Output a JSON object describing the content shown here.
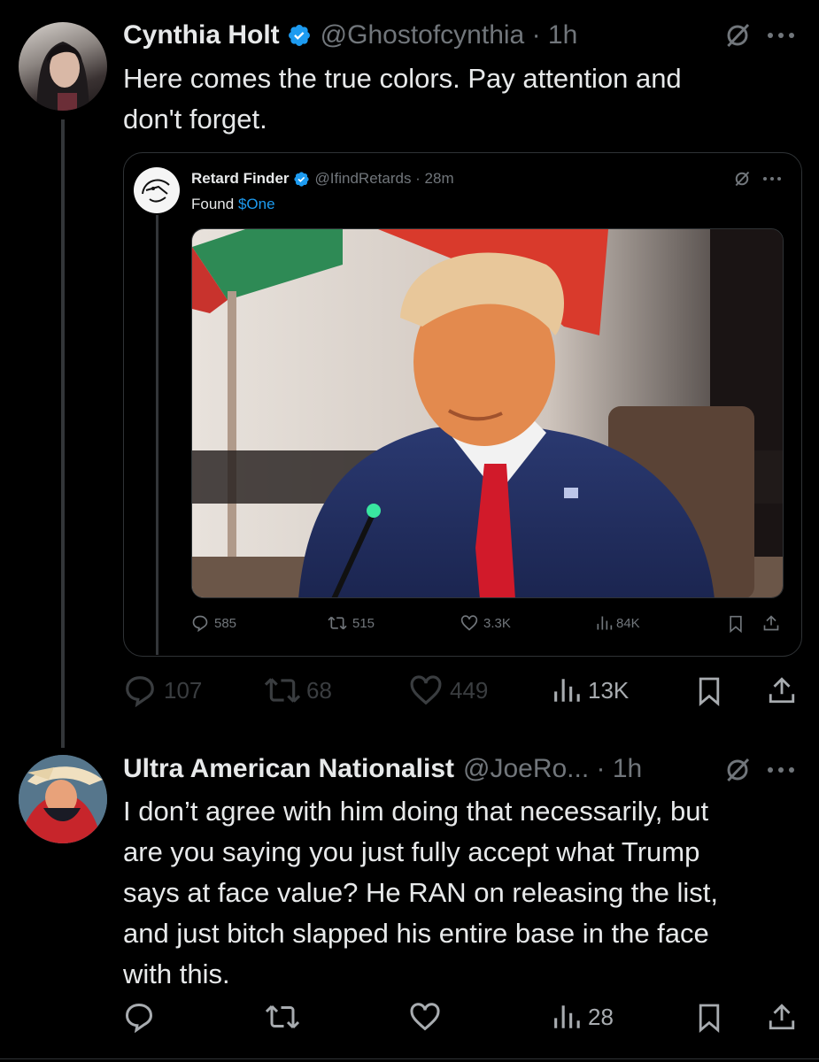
{
  "colors": {
    "background": "#000000",
    "text": "#e7e9ea",
    "muted": "#71767b",
    "accent": "#1d9bf0",
    "verified": "#1d9bf0",
    "divider": "#2f3336"
  },
  "post1": {
    "author_name": "Cynthia Holt",
    "handle_time": "@Ghostofcynthia · 1h",
    "text_line1": "Here comes the true colors. Pay attention and",
    "text_line2": "don't forget.",
    "quote": {
      "author_name": "Retard Finder",
      "handle_time": "@IfindRetards · 28m",
      "text_prefix": "Found",
      "cashtag": "$One",
      "replies": "585",
      "reposts": "515",
      "likes": "3.3K",
      "views": "84K"
    },
    "replies": "107",
    "reposts": "68",
    "likes": "449",
    "views": "13K"
  },
  "post2": {
    "author_name": "Ultra American Nationalist",
    "handle_time": "@JoeRo... · 1h",
    "lines": [
      "I don’t agree with him doing that necessarily, but",
      "are you saying you just fully accept what Trump",
      "says at face value? He RAN on releasing the list,",
      "and just bitch slapped his entire base in the face",
      "with this."
    ],
    "views": "28"
  },
  "icons": [
    "verified-badge-icon",
    "grok-icon",
    "more-icon",
    "reply-icon",
    "repost-icon",
    "like-icon",
    "views-icon",
    "bookmark-icon",
    "share-icon"
  ]
}
